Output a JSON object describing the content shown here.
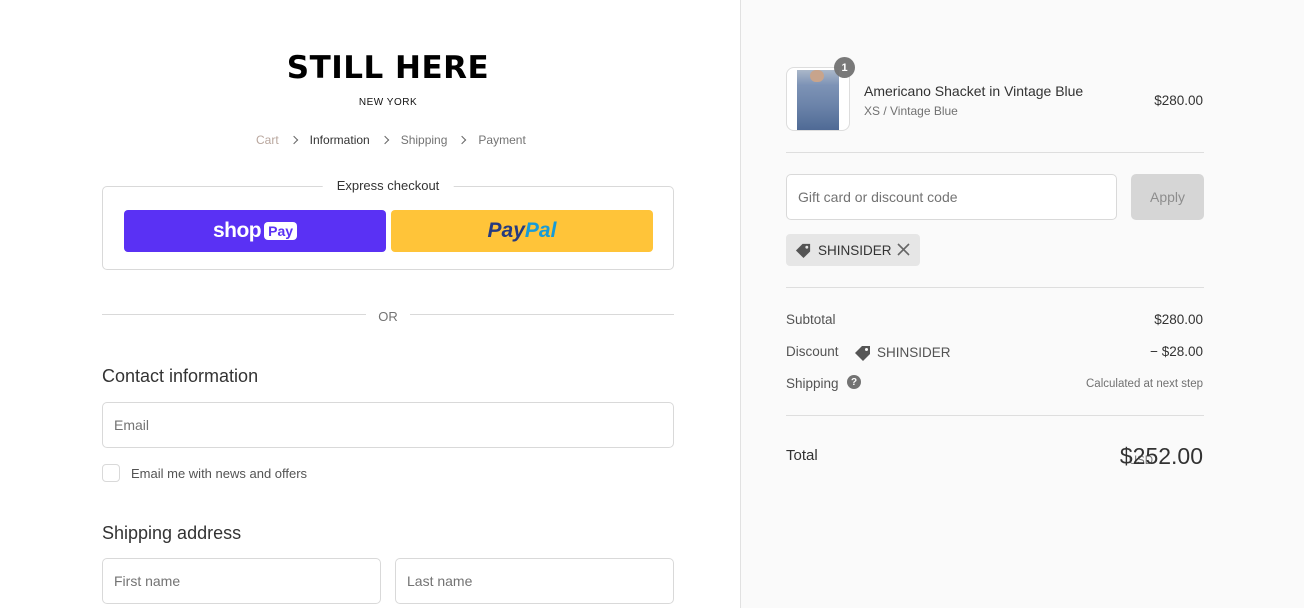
{
  "brand": {
    "name": "STILL HERE",
    "location": "NEW YORK"
  },
  "breadcrumb": {
    "cart": "Cart",
    "information": "Information",
    "shipping": "Shipping",
    "payment": "Payment"
  },
  "express": {
    "title": "Express checkout",
    "shop": "shop",
    "shop_pay": "Pay",
    "paypal_a": "Pay",
    "paypal_b": "Pal",
    "shop_color": "#5a31f4",
    "paypal_color": "#ffc439"
  },
  "divider": "OR",
  "contact": {
    "title": "Contact information",
    "email_placeholder": "Email",
    "newsletter_label": "Email me with news and offers"
  },
  "shipping": {
    "title": "Shipping address",
    "first_name_placeholder": "First name",
    "last_name_placeholder": "Last name"
  },
  "order": {
    "item": {
      "quantity": "1",
      "name": "Americano Shacket in Vintage Blue",
      "variant": "XS / Vintage Blue",
      "price": "$280.00"
    },
    "discount_placeholder": "Gift card or discount code",
    "apply_label": "Apply",
    "applied_code": "SHINSIDER",
    "subtotal_label": "Subtotal",
    "subtotal_value": "$280.00",
    "discount_label": "Discount",
    "discount_code": "SHINSIDER",
    "discount_value": "− $28.00",
    "shipping_label": "Shipping",
    "shipping_value": "Calculated at next step",
    "total_label": "Total",
    "currency": "USD",
    "total_value": "$252.00"
  }
}
